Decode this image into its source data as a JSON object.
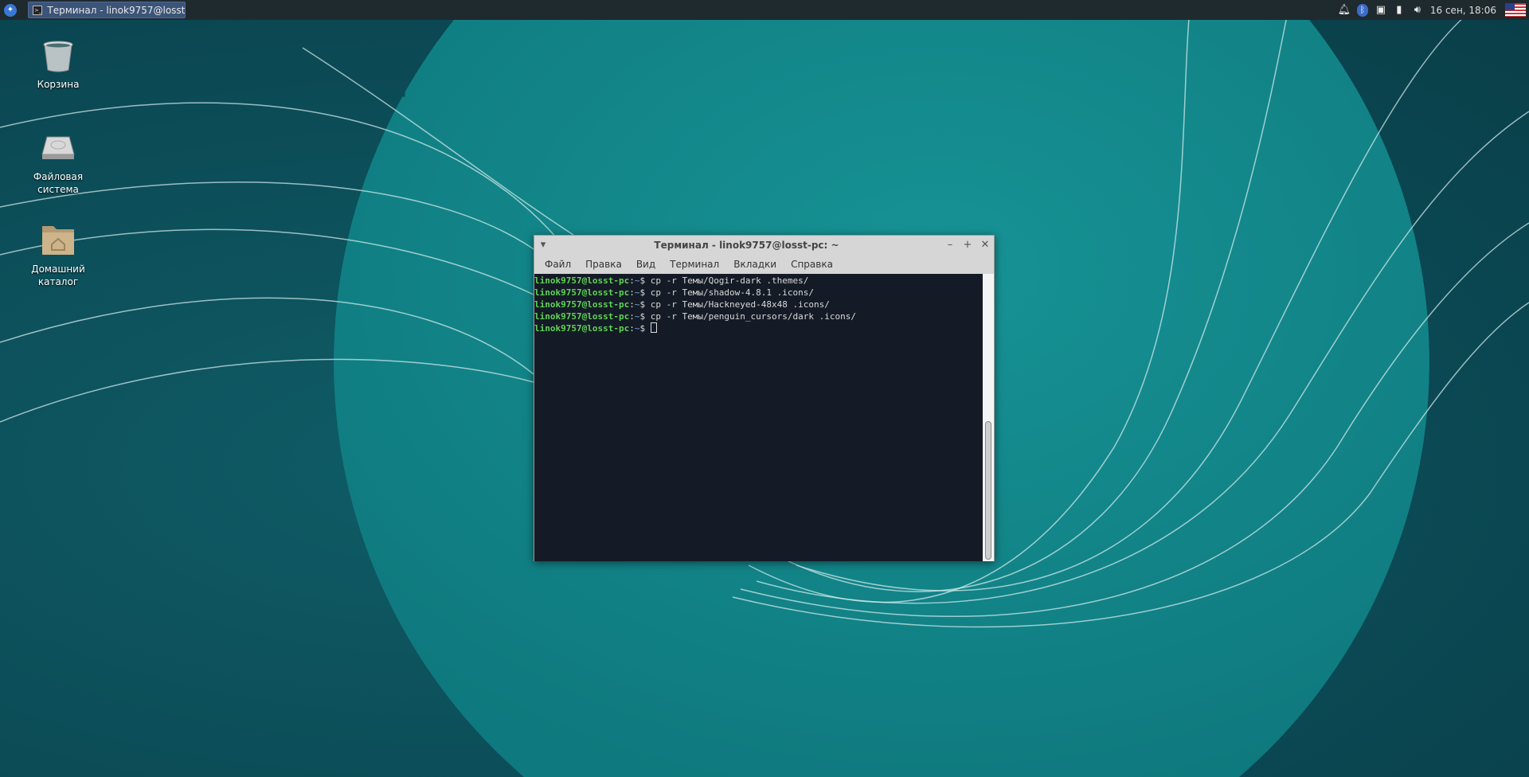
{
  "taskbar": {
    "window_button": "Терминал - linok9757@losst...",
    "clock": "16 сен, 18:06",
    "tray_icons": [
      "bell-icon",
      "bluetooth-icon",
      "network-icon",
      "battery-icon",
      "volume-icon",
      "us-flag-icon"
    ]
  },
  "desktop": {
    "icons": [
      {
        "label": "Корзина"
      },
      {
        "label": "Файловая система"
      },
      {
        "label": "Домашний каталог"
      }
    ]
  },
  "terminal": {
    "title": "Терминал - linok9757@losst-pc: ~",
    "menu": [
      "Файл",
      "Правка",
      "Вид",
      "Терминал",
      "Вкладки",
      "Справка"
    ],
    "prompt_user": "linok9757@losst-pc",
    "prompt_path": "~",
    "lines": [
      {
        "cmd": "cp -r Темы/Qogir-dark .themes/"
      },
      {
        "cmd": "cp -r Темы/shadow-4.8.1 .icons/"
      },
      {
        "cmd": "cp -r Темы/Hackneyed-48x48 .icons/"
      },
      {
        "cmd": "cp -r Темы/penguin_cursors/dark .icons/"
      },
      {
        "cmd": ""
      }
    ],
    "scroll_position": 1.0
  }
}
